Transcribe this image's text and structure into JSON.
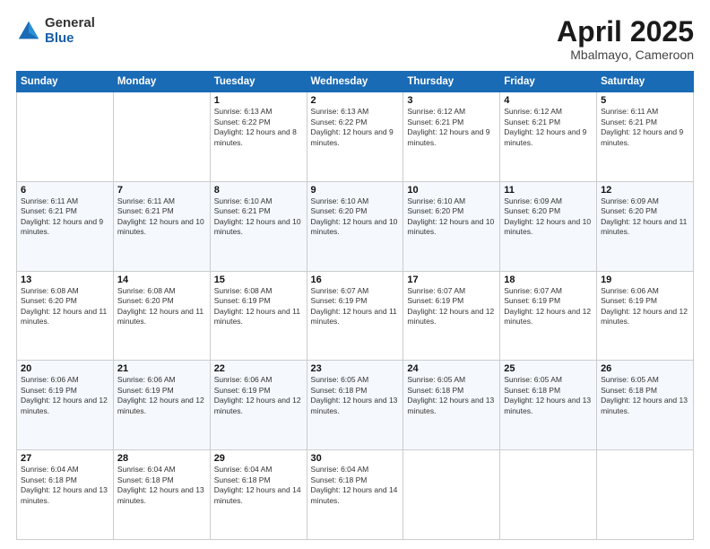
{
  "logo": {
    "general": "General",
    "blue": "Blue"
  },
  "header": {
    "title": "April 2025",
    "subtitle": "Mbalmayo, Cameroon"
  },
  "weekdays": [
    "Sunday",
    "Monday",
    "Tuesday",
    "Wednesday",
    "Thursday",
    "Friday",
    "Saturday"
  ],
  "weeks": [
    [
      {
        "day": "",
        "info": ""
      },
      {
        "day": "",
        "info": ""
      },
      {
        "day": "1",
        "info": "Sunrise: 6:13 AM\nSunset: 6:22 PM\nDaylight: 12 hours and 8 minutes."
      },
      {
        "day": "2",
        "info": "Sunrise: 6:13 AM\nSunset: 6:22 PM\nDaylight: 12 hours and 9 minutes."
      },
      {
        "day": "3",
        "info": "Sunrise: 6:12 AM\nSunset: 6:21 PM\nDaylight: 12 hours and 9 minutes."
      },
      {
        "day": "4",
        "info": "Sunrise: 6:12 AM\nSunset: 6:21 PM\nDaylight: 12 hours and 9 minutes."
      },
      {
        "day": "5",
        "info": "Sunrise: 6:11 AM\nSunset: 6:21 PM\nDaylight: 12 hours and 9 minutes."
      }
    ],
    [
      {
        "day": "6",
        "info": "Sunrise: 6:11 AM\nSunset: 6:21 PM\nDaylight: 12 hours and 9 minutes."
      },
      {
        "day": "7",
        "info": "Sunrise: 6:11 AM\nSunset: 6:21 PM\nDaylight: 12 hours and 10 minutes."
      },
      {
        "day": "8",
        "info": "Sunrise: 6:10 AM\nSunset: 6:21 PM\nDaylight: 12 hours and 10 minutes."
      },
      {
        "day": "9",
        "info": "Sunrise: 6:10 AM\nSunset: 6:20 PM\nDaylight: 12 hours and 10 minutes."
      },
      {
        "day": "10",
        "info": "Sunrise: 6:10 AM\nSunset: 6:20 PM\nDaylight: 12 hours and 10 minutes."
      },
      {
        "day": "11",
        "info": "Sunrise: 6:09 AM\nSunset: 6:20 PM\nDaylight: 12 hours and 10 minutes."
      },
      {
        "day": "12",
        "info": "Sunrise: 6:09 AM\nSunset: 6:20 PM\nDaylight: 12 hours and 11 minutes."
      }
    ],
    [
      {
        "day": "13",
        "info": "Sunrise: 6:08 AM\nSunset: 6:20 PM\nDaylight: 12 hours and 11 minutes."
      },
      {
        "day": "14",
        "info": "Sunrise: 6:08 AM\nSunset: 6:20 PM\nDaylight: 12 hours and 11 minutes."
      },
      {
        "day": "15",
        "info": "Sunrise: 6:08 AM\nSunset: 6:19 PM\nDaylight: 12 hours and 11 minutes."
      },
      {
        "day": "16",
        "info": "Sunrise: 6:07 AM\nSunset: 6:19 PM\nDaylight: 12 hours and 11 minutes."
      },
      {
        "day": "17",
        "info": "Sunrise: 6:07 AM\nSunset: 6:19 PM\nDaylight: 12 hours and 12 minutes."
      },
      {
        "day": "18",
        "info": "Sunrise: 6:07 AM\nSunset: 6:19 PM\nDaylight: 12 hours and 12 minutes."
      },
      {
        "day": "19",
        "info": "Sunrise: 6:06 AM\nSunset: 6:19 PM\nDaylight: 12 hours and 12 minutes."
      }
    ],
    [
      {
        "day": "20",
        "info": "Sunrise: 6:06 AM\nSunset: 6:19 PM\nDaylight: 12 hours and 12 minutes."
      },
      {
        "day": "21",
        "info": "Sunrise: 6:06 AM\nSunset: 6:19 PM\nDaylight: 12 hours and 12 minutes."
      },
      {
        "day": "22",
        "info": "Sunrise: 6:06 AM\nSunset: 6:19 PM\nDaylight: 12 hours and 12 minutes."
      },
      {
        "day": "23",
        "info": "Sunrise: 6:05 AM\nSunset: 6:18 PM\nDaylight: 12 hours and 13 minutes."
      },
      {
        "day": "24",
        "info": "Sunrise: 6:05 AM\nSunset: 6:18 PM\nDaylight: 12 hours and 13 minutes."
      },
      {
        "day": "25",
        "info": "Sunrise: 6:05 AM\nSunset: 6:18 PM\nDaylight: 12 hours and 13 minutes."
      },
      {
        "day": "26",
        "info": "Sunrise: 6:05 AM\nSunset: 6:18 PM\nDaylight: 12 hours and 13 minutes."
      }
    ],
    [
      {
        "day": "27",
        "info": "Sunrise: 6:04 AM\nSunset: 6:18 PM\nDaylight: 12 hours and 13 minutes."
      },
      {
        "day": "28",
        "info": "Sunrise: 6:04 AM\nSunset: 6:18 PM\nDaylight: 12 hours and 13 minutes."
      },
      {
        "day": "29",
        "info": "Sunrise: 6:04 AM\nSunset: 6:18 PM\nDaylight: 12 hours and 14 minutes."
      },
      {
        "day": "30",
        "info": "Sunrise: 6:04 AM\nSunset: 6:18 PM\nDaylight: 12 hours and 14 minutes."
      },
      {
        "day": "",
        "info": ""
      },
      {
        "day": "",
        "info": ""
      },
      {
        "day": "",
        "info": ""
      }
    ]
  ]
}
